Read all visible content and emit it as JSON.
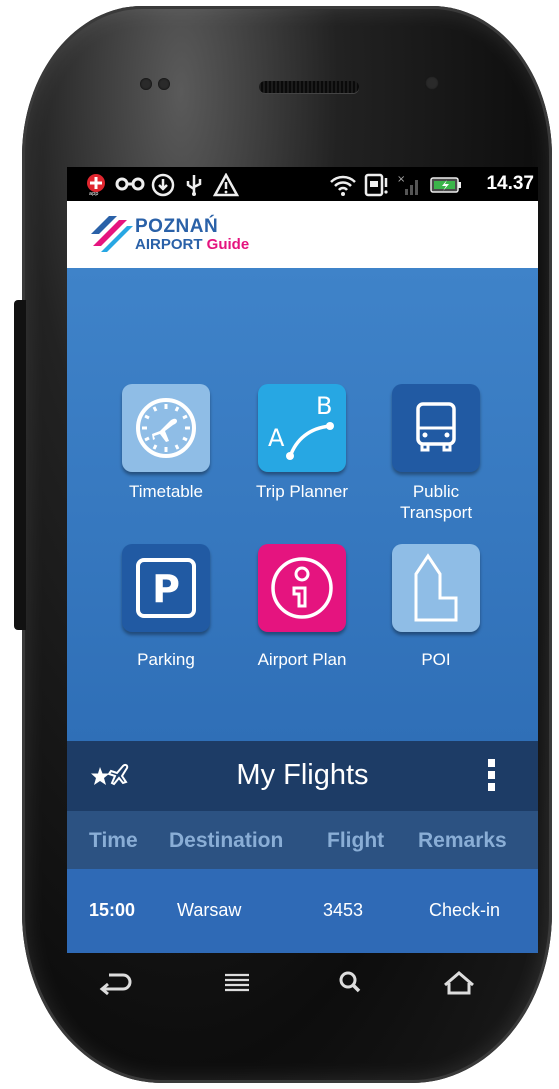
{
  "status_bar": {
    "time": "14.37",
    "icons": [
      "app-notification-icon",
      "link-icon",
      "download-icon",
      "usb-icon",
      "warning-icon",
      "wifi-icon",
      "sim-icon",
      "signal-icon",
      "battery-icon"
    ]
  },
  "app": {
    "logo_line1": "POZNAŃ",
    "logo_line2": "AIRPORT",
    "logo_line2_guide": "Guide"
  },
  "tiles": [
    {
      "label": "Timetable",
      "icon": "clock-plane-icon",
      "color": "#8fbde6"
    },
    {
      "label": "Trip Planner",
      "icon": "route-ab-icon",
      "color": "#27a7e3"
    },
    {
      "label": "Public\nTransport",
      "icon": "bus-icon",
      "color": "#215aa3"
    },
    {
      "label": "Parking",
      "icon": "parking-icon",
      "color": "#215aa3"
    },
    {
      "label": "Airport Plan",
      "icon": "info-icon",
      "color": "#e5147f"
    },
    {
      "label": "POI",
      "icon": "building-icon",
      "color": "#8fbde6"
    }
  ],
  "my_flights": {
    "title": "My Flights",
    "columns": [
      "Time",
      "Destination",
      "Flight",
      "Remarks"
    ],
    "rows": [
      {
        "time": "15:00",
        "destination": "Warsaw",
        "flight": "3453",
        "remarks": "Check-in"
      }
    ]
  },
  "nav": [
    "back-icon",
    "menu-icon",
    "search-icon",
    "home-icon"
  ]
}
